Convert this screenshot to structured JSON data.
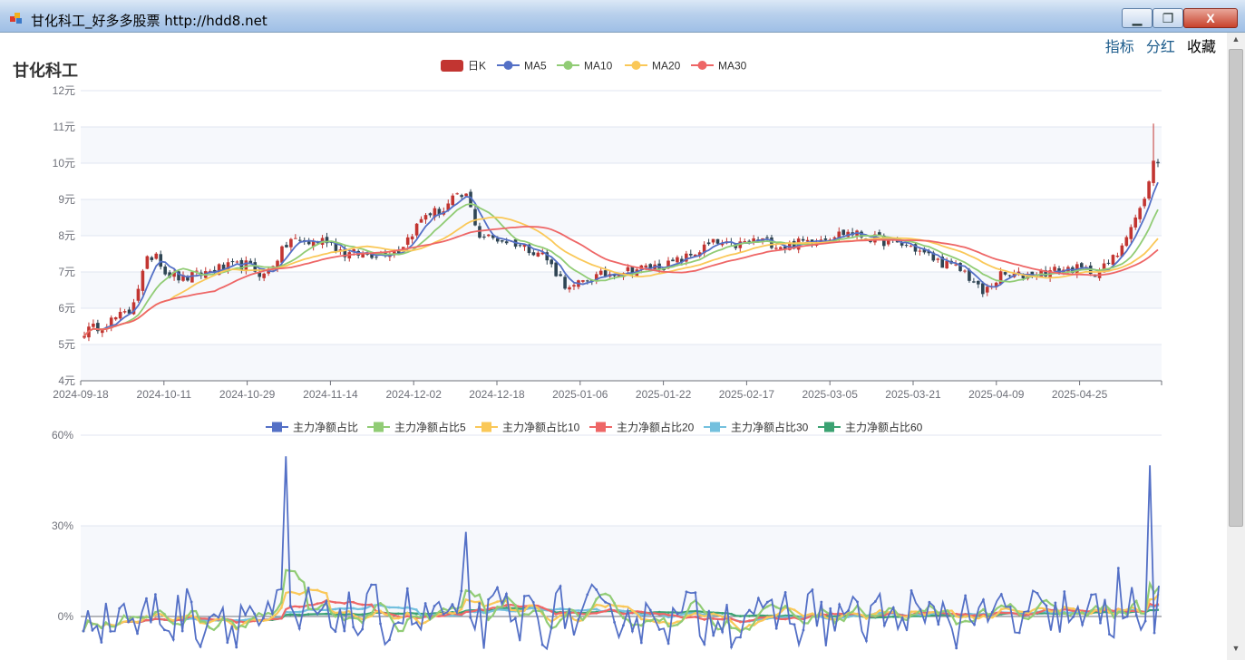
{
  "window": {
    "title": "甘化科工_好多多股票  http://hdd8.net",
    "min_label": "▁",
    "max_label": "❐",
    "close_label": "X"
  },
  "toplinks": {
    "indicator": "指标",
    "fenhong": "分红",
    "favorite": "收藏"
  },
  "colors": {
    "up": "#c23531",
    "down": "#2f4554",
    "ma5": "#5470c6",
    "ma10": "#91cc75",
    "ma20": "#fac858",
    "ma30": "#ee6666",
    "ratio30": "#73c0de",
    "ratio60": "#3ba272"
  },
  "chart_data": [
    {
      "type": "candlestick",
      "title": "甘化科工",
      "legend": [
        "日K",
        "MA5",
        "MA10",
        "MA20",
        "MA30"
      ],
      "legend_position": "top-center",
      "yunit": "元",
      "ylim": [
        4,
        12
      ],
      "yticks": [
        "4元",
        "5元",
        "6元",
        "7元",
        "8元",
        "9元",
        "10元",
        "11元",
        "12元"
      ],
      "xticks": [
        "2024-09-18",
        "2024-10-11",
        "2024-10-29",
        "2024-11-14",
        "2024-12-02",
        "2024-12-18",
        "2025-01-06",
        "2025-01-22",
        "2025-02-17",
        "2025-03-05",
        "2025-03-21",
        "2025-04-09",
        "2025-04-25"
      ],
      "close_key": [
        [
          0,
          5.35
        ],
        [
          4,
          5.55
        ],
        [
          10,
          5.9
        ],
        [
          14,
          7.3
        ],
        [
          16,
          7.55
        ],
        [
          18,
          7.0
        ],
        [
          22,
          6.8
        ],
        [
          30,
          7.1
        ],
        [
          36,
          7.2
        ],
        [
          40,
          6.9
        ],
        [
          46,
          7.9
        ],
        [
          50,
          7.8
        ],
        [
          54,
          7.9
        ],
        [
          58,
          7.5
        ],
        [
          64,
          7.5
        ],
        [
          70,
          7.6
        ],
        [
          76,
          8.6
        ],
        [
          80,
          8.7
        ],
        [
          82,
          9.0
        ],
        [
          85,
          9.1
        ],
        [
          88,
          8.0
        ],
        [
          92,
          7.9
        ],
        [
          96,
          7.8
        ],
        [
          102,
          7.5
        ],
        [
          108,
          6.5
        ],
        [
          112,
          6.8
        ],
        [
          118,
          7.0
        ],
        [
          124,
          7.1
        ],
        [
          130,
          7.2
        ],
        [
          134,
          7.4
        ],
        [
          140,
          7.8
        ],
        [
          144,
          7.7
        ],
        [
          150,
          7.9
        ],
        [
          156,
          7.7
        ],
        [
          162,
          7.9
        ],
        [
          170,
          8.1
        ],
        [
          176,
          7.9
        ],
        [
          184,
          7.7
        ],
        [
          190,
          7.3
        ],
        [
          196,
          7.0
        ],
        [
          200,
          6.4
        ],
        [
          204,
          6.9
        ],
        [
          208,
          6.9
        ],
        [
          214,
          7.0
        ],
        [
          220,
          7.1
        ],
        [
          226,
          7.0
        ],
        [
          230,
          7.5
        ],
        [
          234,
          8.5
        ],
        [
          236,
          9.0
        ],
        [
          238,
          10.05
        ],
        [
          239,
          10.0
        ]
      ]
    },
    {
      "type": "line",
      "legend": [
        "主力净额占比",
        "主力净额占比5",
        "主力净额占比10",
        "主力净额占比20",
        "主力净额占比30",
        "主力净额占比60"
      ],
      "legend_position": "top-center",
      "yunit": "%",
      "ylim": [
        -20,
        60
      ],
      "yticks": [
        "0%",
        "30%",
        "60%"
      ],
      "spikes": [
        [
          45,
          53
        ],
        [
          85,
          28
        ],
        [
          230,
          16
        ],
        [
          237,
          50
        ]
      ]
    }
  ]
}
